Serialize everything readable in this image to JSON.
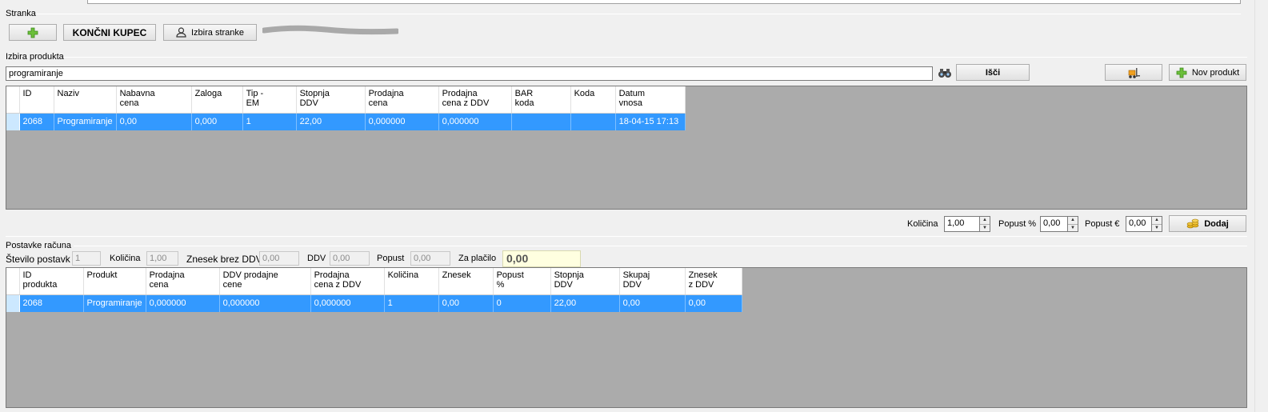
{
  "stranka": {
    "group_label": "Stranka",
    "koncni_kupec_label": "KONČNI KUPEC",
    "izbira_stranke_label": "Izbira stranke"
  },
  "produkt": {
    "group_label": "Izbira produkta",
    "search_value": "programiranje",
    "search_button": "Išči",
    "nov_produkt_button": "Nov produkt",
    "columns": [
      "ID",
      "Naziv",
      "Nabavna\ncena",
      "Zaloga",
      "Tip -\nEM",
      "Stopnja\nDDV",
      "Prodajna\ncena",
      "Prodajna\ncena z DDV",
      "BAR\nkoda",
      "Koda",
      "Datum\nvnosa"
    ],
    "rows": [
      [
        "2068",
        "Programiranje",
        "0,00",
        "0,000",
        "1",
        "22,00",
        "0,000000",
        "0,000000",
        "",
        "",
        "18-04-15 17:13"
      ]
    ]
  },
  "add": {
    "kolicina_label": "Količina",
    "kolicina_value": "1,00",
    "popust_pct_label": "Popust %",
    "popust_pct_value": "0,00",
    "popust_eur_label": "Popust €",
    "popust_eur_value": "0,00",
    "dodaj_button": "Dodaj"
  },
  "postavke": {
    "group_label": "Postavke računa",
    "stevilo_label": "Število postavk",
    "stevilo_value": "1",
    "kolicina_label": "Količina",
    "kolicina_value": "1,00",
    "znesek_label": "Znesek brez DDV",
    "znesek_value": "0,00",
    "ddv_label": "DDV",
    "ddv_value": "0,00",
    "popust_label": "Popust",
    "popust_value": "0,00",
    "zaplacilo_label": "Za plačilo",
    "zaplacilo_value": "0,00",
    "columns": [
      "ID\nprodukta",
      "Produkt",
      "Prodajna\ncena",
      "DDV prodajne\ncene",
      "Prodajna\ncena z DDV",
      "Količina",
      "Znesek",
      "Popust\n%",
      "Stopnja\nDDV",
      "Skupaj\nDDV",
      "Znesek\nz DDV"
    ],
    "rows": [
      [
        "2068",
        "Programiranje",
        "0,000000",
        "0,000000",
        "0,000000",
        "1",
        "0,00",
        "0",
        "22,00",
        "0,00",
        "0,00"
      ]
    ]
  },
  "colors": {
    "selection": "#3399ff",
    "grid_bg": "#ababab",
    "total_bg": "#ffffe0"
  },
  "icons": [
    "plus-icon",
    "user-icon",
    "binoculars-icon",
    "forklift-icon",
    "coins-icon"
  ]
}
